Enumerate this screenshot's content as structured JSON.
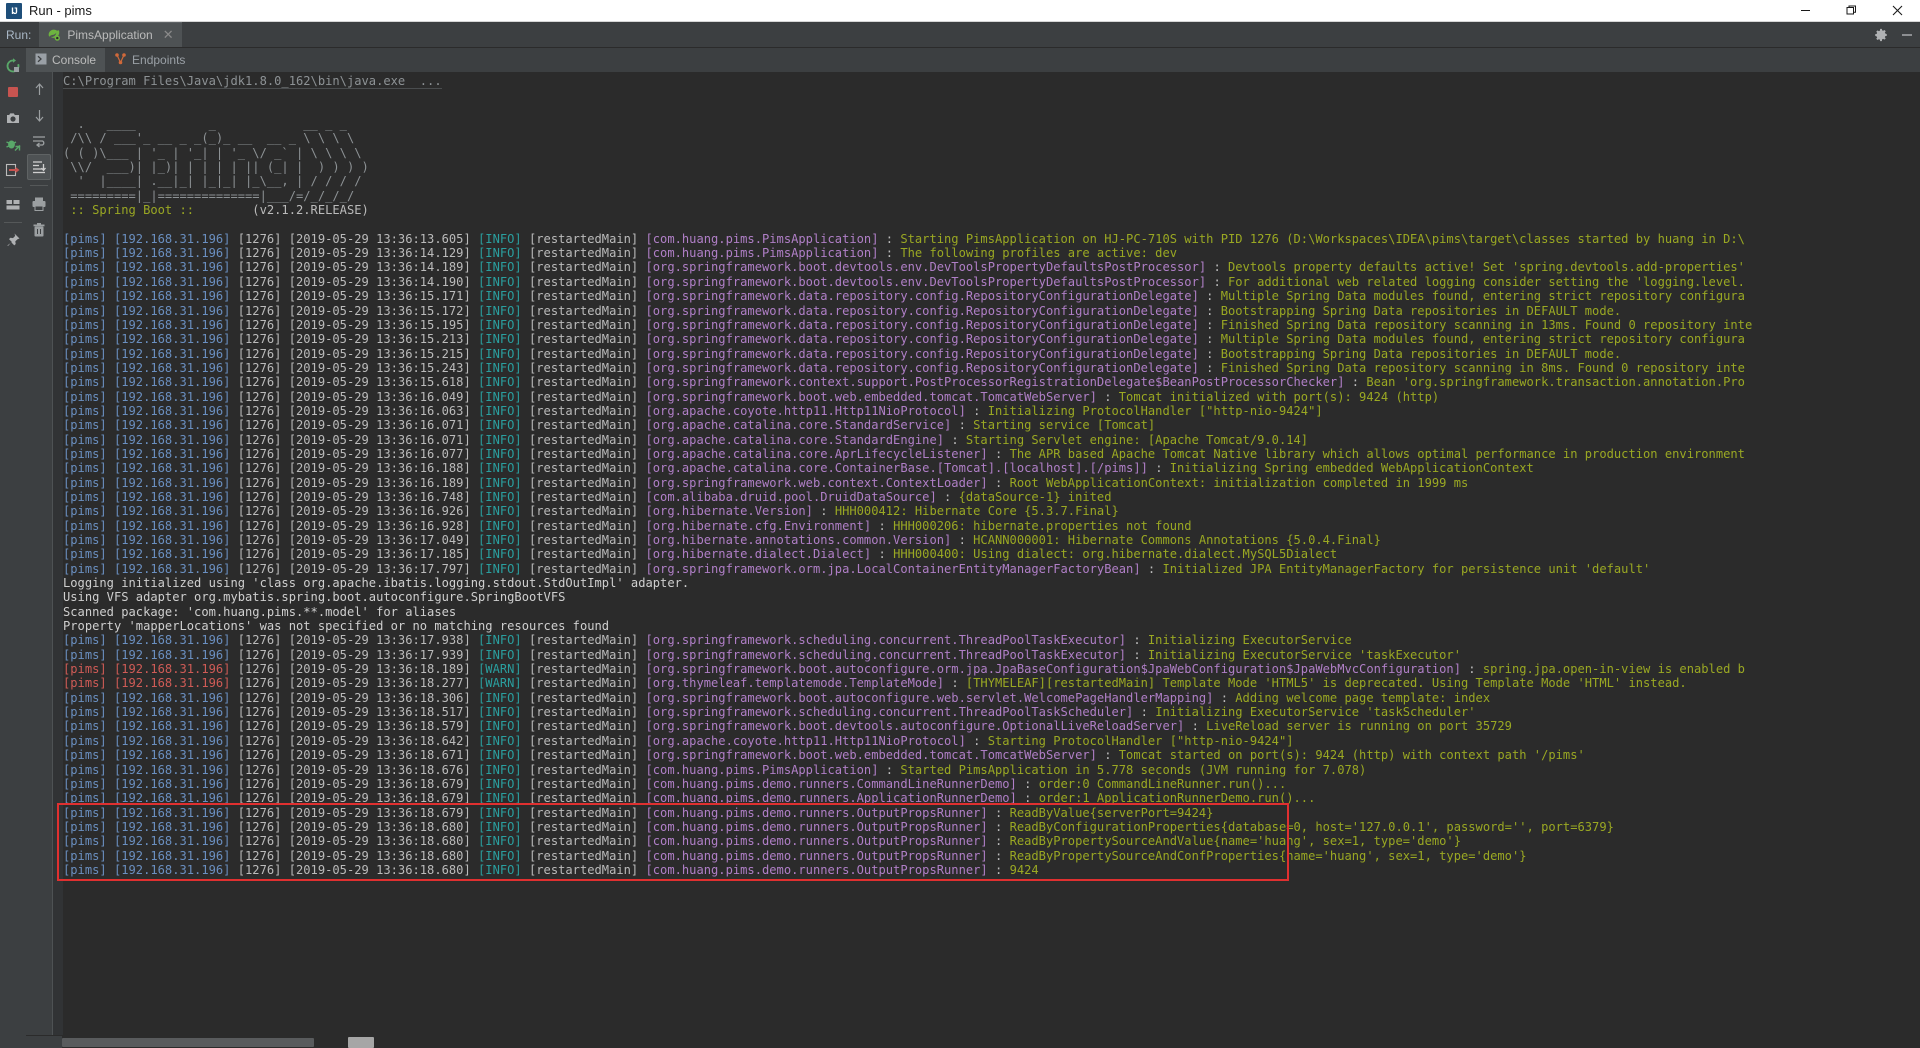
{
  "window": {
    "title": "Run - pims",
    "app_icon": "intellij-idea-icon",
    "controls": {
      "minimize": "—",
      "maximize": "❐",
      "close": "✕"
    }
  },
  "runbar": {
    "label": "Run:",
    "tab_name": "PimsApplication",
    "tab_close": "✕",
    "settings_icon": "gear-icon",
    "hide_icon": "minimize-icon"
  },
  "left_toolbar": [
    {
      "name": "rerun-button",
      "icon": "rerun-icon",
      "color": "#59a869"
    },
    {
      "name": "stop-button",
      "icon": "stop-square-icon",
      "color": "#c75450"
    },
    {
      "name": "screenshot-button",
      "icon": "camera-icon",
      "color": "#afb1b3"
    },
    {
      "name": "debug-attach-button",
      "icon": "bug-attach-icon",
      "color": "#59a869"
    },
    {
      "name": "resume-program-button",
      "icon": "resume-arrow-icon",
      "color": "#c75450"
    },
    {
      "name": "layout-button",
      "icon": "layout-panels-icon",
      "color": "#afb1b3"
    },
    {
      "name": "pin-tab-button",
      "icon": "pin-icon",
      "color": "#afb1b3"
    }
  ],
  "console_tabs": [
    {
      "label": "Console",
      "icon": "console-icon",
      "active": true
    },
    {
      "label": "Endpoints",
      "icon": "endpoints-icon",
      "active": false
    }
  ],
  "console_side_toolbar": [
    {
      "name": "up-button",
      "icon": "arrow-up-icon"
    },
    {
      "name": "down-button",
      "icon": "arrow-down-icon"
    },
    {
      "name": "soft-wrap-button",
      "icon": "soft-wrap-icon"
    },
    {
      "name": "scroll-to-end-button",
      "icon": "scroll-to-end-icon",
      "selected": true
    },
    {
      "name": "print-button",
      "icon": "printer-icon"
    },
    {
      "name": "clear-all-button",
      "icon": "trash-icon"
    }
  ],
  "console": {
    "command_line": "C:\\Program Files\\Java\\jdk1.8.0_162\\bin\\java.exe  ...",
    "banner": [
      "  .   ____          _            __ _ _",
      " /\\\\ / ___'_ __ _ _(_)_ __  __ _ \\ \\ \\ \\",
      "( ( )\\___ | '_ | '_| | '_ \\/ _` | \\ \\ \\ \\",
      " \\\\/  ___)| |_)| | | | | || (_| |  ) ) ) )",
      "  '  |____| .__|_| |_|_| |_\\__, | / / / /",
      " =========|_|==============|___/=/_/_/_/"
    ],
    "banner_footer_left": " :: Spring Boot :: ",
    "banner_footer_right": "       (v2.1.2.RELEASE)",
    "plain_lines": [
      "Logging initialized using 'class org.apache.ibatis.logging.stdout.StdOutImpl' adapter.",
      "Using VFS adapter org.mybatis.spring.boot.autoconfigure.SpringBootVFS",
      "Scanned package: 'com.huang.pims.**.model' for aliases",
      "Property 'mapperLocations' was not specified or no matching resources found"
    ],
    "app": "[pims]",
    "ip": "[192.168.31.196]",
    "pid": "[1276]",
    "thread": "[restartedMain]",
    "log_lines": [
      {
        "time": "[2019-05-29 13:36:13.605]",
        "level": "INFO",
        "logger": "[com.huang.pims.PimsApplication]",
        "msg": "Starting PimsApplication on HJ-PC-710S with PID 1276 (D:\\Workspaces\\IDEA\\pims\\target\\classes started by huang in D:\\"
      },
      {
        "time": "[2019-05-29 13:36:14.129]",
        "level": "INFO",
        "logger": "[com.huang.pims.PimsApplication]",
        "msg": "The following profiles are active: dev"
      },
      {
        "time": "[2019-05-29 13:36:14.189]",
        "level": "INFO",
        "logger": "[org.springframework.boot.devtools.env.DevToolsPropertyDefaultsPostProcessor]",
        "msg": "Devtools property defaults active! Set 'spring.devtools.add-properties'"
      },
      {
        "time": "[2019-05-29 13:36:14.190]",
        "level": "INFO",
        "logger": "[org.springframework.boot.devtools.env.DevToolsPropertyDefaultsPostProcessor]",
        "msg": "For additional web related logging consider setting the 'logging.level."
      },
      {
        "time": "[2019-05-29 13:36:15.171]",
        "level": "INFO",
        "logger": "[org.springframework.data.repository.config.RepositoryConfigurationDelegate]",
        "msg": "Multiple Spring Data modules found, entering strict repository configura"
      },
      {
        "time": "[2019-05-29 13:36:15.172]",
        "level": "INFO",
        "logger": "[org.springframework.data.repository.config.RepositoryConfigurationDelegate]",
        "msg": "Bootstrapping Spring Data repositories in DEFAULT mode."
      },
      {
        "time": "[2019-05-29 13:36:15.195]",
        "level": "INFO",
        "logger": "[org.springframework.data.repository.config.RepositoryConfigurationDelegate]",
        "msg": "Finished Spring Data repository scanning in 13ms. Found 0 repository inte"
      },
      {
        "time": "[2019-05-29 13:36:15.213]",
        "level": "INFO",
        "logger": "[org.springframework.data.repository.config.RepositoryConfigurationDelegate]",
        "msg": "Multiple Spring Data modules found, entering strict repository configura"
      },
      {
        "time": "[2019-05-29 13:36:15.215]",
        "level": "INFO",
        "logger": "[org.springframework.data.repository.config.RepositoryConfigurationDelegate]",
        "msg": "Bootstrapping Spring Data repositories in DEFAULT mode."
      },
      {
        "time": "[2019-05-29 13:36:15.243]",
        "level": "INFO",
        "logger": "[org.springframework.data.repository.config.RepositoryConfigurationDelegate]",
        "msg": "Finished Spring Data repository scanning in 8ms. Found 0 repository inte"
      },
      {
        "time": "[2019-05-29 13:36:15.618]",
        "level": "INFO",
        "logger": "[org.springframework.context.support.PostProcessorRegistrationDelegate$BeanPostProcessorChecker]",
        "msg": "Bean 'org.springframework.transaction.annotation.Pro"
      },
      {
        "time": "[2019-05-29 13:36:16.049]",
        "level": "INFO",
        "logger": "[org.springframework.boot.web.embedded.tomcat.TomcatWebServer]",
        "msg": "Tomcat initialized with port(s): 9424 (http)"
      },
      {
        "time": "[2019-05-29 13:36:16.063]",
        "level": "INFO",
        "logger": "[org.apache.coyote.http11.Http11NioProtocol]",
        "msg": "Initializing ProtocolHandler [\"http-nio-9424\"]"
      },
      {
        "time": "[2019-05-29 13:36:16.071]",
        "level": "INFO",
        "logger": "[org.apache.catalina.core.StandardService]",
        "msg": "Starting service [Tomcat]"
      },
      {
        "time": "[2019-05-29 13:36:16.071]",
        "level": "INFO",
        "logger": "[org.apache.catalina.core.StandardEngine]",
        "msg": "Starting Servlet engine: [Apache Tomcat/9.0.14]"
      },
      {
        "time": "[2019-05-29 13:36:16.077]",
        "level": "INFO",
        "logger": "[org.apache.catalina.core.AprLifecycleListener]",
        "msg": "The APR based Apache Tomcat Native library which allows optimal performance in production environment"
      },
      {
        "time": "[2019-05-29 13:36:16.188]",
        "level": "INFO",
        "logger": "[org.apache.catalina.core.ContainerBase.[Tomcat].[localhost].[/pims]]",
        "msg": "Initializing Spring embedded WebApplicationContext"
      },
      {
        "time": "[2019-05-29 13:36:16.189]",
        "level": "INFO",
        "logger": "[org.springframework.web.context.ContextLoader]",
        "msg": "Root WebApplicationContext: initialization completed in 1999 ms"
      },
      {
        "time": "[2019-05-29 13:36:16.748]",
        "level": "INFO",
        "logger": "[com.alibaba.druid.pool.DruidDataSource]",
        "msg": "{dataSource-1} inited"
      },
      {
        "time": "[2019-05-29 13:36:16.926]",
        "level": "INFO",
        "logger": "[org.hibernate.Version]",
        "msg": "HHH000412: Hibernate Core {5.3.7.Final}"
      },
      {
        "time": "[2019-05-29 13:36:16.928]",
        "level": "INFO",
        "logger": "[org.hibernate.cfg.Environment]",
        "msg": "HHH000206: hibernate.properties not found"
      },
      {
        "time": "[2019-05-29 13:36:17.049]",
        "level": "INFO",
        "logger": "[org.hibernate.annotations.common.Version]",
        "msg": "HCANN000001: Hibernate Commons Annotations {5.0.4.Final}"
      },
      {
        "time": "[2019-05-29 13:36:17.185]",
        "level": "INFO",
        "logger": "[org.hibernate.dialect.Dialect]",
        "msg": "HHH000400: Using dialect: org.hibernate.dialect.MySQL5Dialect"
      },
      {
        "time": "[2019-05-29 13:36:17.797]",
        "level": "INFO",
        "logger": "[org.springframework.orm.jpa.LocalContainerEntityManagerFactoryBean]",
        "msg": "Initialized JPA EntityManagerFactory for persistence unit 'default'"
      }
    ],
    "log_lines_2": [
      {
        "time": "[2019-05-29 13:36:17.938]",
        "level": "INFO",
        "logger": "[org.springframework.scheduling.concurrent.ThreadPoolTaskExecutor]",
        "msg": "Initializing ExecutorService"
      },
      {
        "time": "[2019-05-29 13:36:17.939]",
        "level": "INFO",
        "logger": "[org.springframework.scheduling.concurrent.ThreadPoolTaskExecutor]",
        "msg": "Initializing ExecutorService 'taskExecutor'"
      },
      {
        "time": "[2019-05-29 13:36:18.189]",
        "level": "WARN",
        "logger": "[org.springframework.boot.autoconfigure.orm.jpa.JpaBaseConfiguration$JpaWebConfiguration$JpaWebMvcConfiguration]",
        "msg": "spring.jpa.open-in-view is enabled b"
      },
      {
        "time": "[2019-05-29 13:36:18.277]",
        "level": "WARN",
        "logger": "[org.thymeleaf.templatemode.TemplateMode]",
        "msg": "[THYMELEAF][restartedMain] Template Mode 'HTML5' is deprecated. Using Template Mode 'HTML' instead."
      },
      {
        "time": "[2019-05-29 13:36:18.306]",
        "level": "INFO",
        "logger": "[org.springframework.boot.autoconfigure.web.servlet.WelcomePageHandlerMapping]",
        "msg": "Adding welcome page template: index"
      },
      {
        "time": "[2019-05-29 13:36:18.517]",
        "level": "INFO",
        "logger": "[org.springframework.scheduling.concurrent.ThreadPoolTaskScheduler]",
        "msg": "Initializing ExecutorService 'taskScheduler'"
      },
      {
        "time": "[2019-05-29 13:36:18.579]",
        "level": "INFO",
        "logger": "[org.springframework.boot.devtools.autoconfigure.OptionalLiveReloadServer]",
        "msg": "LiveReload server is running on port 35729"
      },
      {
        "time": "[2019-05-29 13:36:18.642]",
        "level": "INFO",
        "logger": "[org.apache.coyote.http11.Http11NioProtocol]",
        "msg": "Starting ProtocolHandler [\"http-nio-9424\"]"
      },
      {
        "time": "[2019-05-29 13:36:18.671]",
        "level": "INFO",
        "logger": "[org.springframework.boot.web.embedded.tomcat.TomcatWebServer]",
        "msg": "Tomcat started on port(s): 9424 (http) with context path '/pims'"
      },
      {
        "time": "[2019-05-29 13:36:18.676]",
        "level": "INFO",
        "logger": "[com.huang.pims.PimsApplication]",
        "msg": "Started PimsApplication in 5.778 seconds (JVM running for 7.078)"
      },
      {
        "time": "[2019-05-29 13:36:18.679]",
        "level": "INFO",
        "logger": "[com.huang.pims.demo.runners.CommandLineRunnerDemo]",
        "msg": "order:0 CommandLineRunner.run()..."
      },
      {
        "time": "[2019-05-29 13:36:18.679]",
        "level": "INFO",
        "logger": "[com.huang.pims.demo.runners.ApplicationRunnerDemo]",
        "msg": "order:1 ApplicationRunnerDemo.run()..."
      }
    ],
    "highlighted_lines": [
      {
        "time": "[2019-05-29 13:36:18.679]",
        "level": "INFO",
        "logger": "[com.huang.pims.demo.runners.OutputPropsRunner]",
        "msg": "ReadByValue{serverPort=9424}"
      },
      {
        "time": "[2019-05-29 13:36:18.680]",
        "level": "INFO",
        "logger": "[com.huang.pims.demo.runners.OutputPropsRunner]",
        "msg": "ReadByConfigurationProperties{database=0, host='127.0.0.1', password='', port=6379}"
      },
      {
        "time": "[2019-05-29 13:36:18.680]",
        "level": "INFO",
        "logger": "[com.huang.pims.demo.runners.OutputPropsRunner]",
        "msg": "ReadByPropertySourceAndValue{name='huang', sex=1, type='demo'}"
      },
      {
        "time": "[2019-05-29 13:36:18.680]",
        "level": "INFO",
        "logger": "[com.huang.pims.demo.runners.OutputPropsRunner]",
        "msg": "ReadByPropertySourceAndConfProperties{name='huang', sex=1, type='demo'}"
      },
      {
        "time": "[2019-05-29 13:36:18.680]",
        "level": "INFO",
        "logger": "[com.huang.pims.demo.runners.OutputPropsRunner]",
        "msg": "9424"
      }
    ]
  },
  "colors": {
    "console_bg": "#2b2b2b",
    "chrome_bg": "#3c3f41",
    "accent_app": "#6a8fc0",
    "accent_warn_app": "#cf5b56",
    "level_info": "#2a9f9f",
    "logger": "#b07fc7",
    "message": "#9aa823",
    "highlight_box": "#e03030"
  }
}
